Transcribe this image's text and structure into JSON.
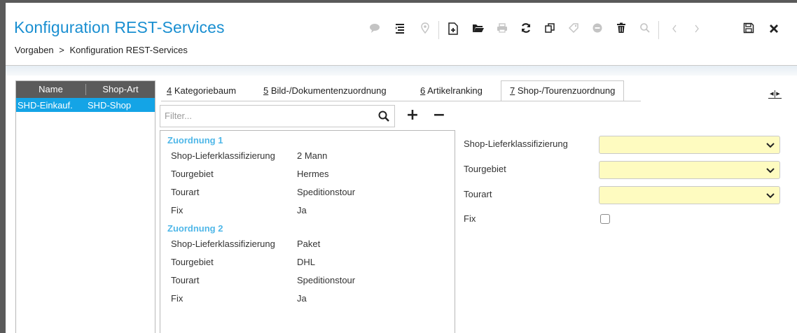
{
  "app": {
    "title": "Konfiguration REST-Services",
    "breadcrumb": {
      "root": "Vorgaben",
      "separator": ">",
      "current": "Konfiguration REST-Services"
    },
    "accent": "#1a8fd1"
  },
  "toolbar": {
    "icons": [
      "comment-icon",
      "list-icon",
      "location-icon",
      "new-document-icon",
      "folder-open-icon",
      "print-icon",
      "refresh-icon",
      "copy-icon",
      "tag-icon",
      "minus-circle-icon",
      "delete-icon",
      "search-icon",
      "prev-icon",
      "next-icon",
      "save-icon",
      "close-icon"
    ]
  },
  "left_list": {
    "headers": [
      "Name",
      "Shop-Art"
    ],
    "rows": [
      {
        "name": "SHD-Einkauf.",
        "shop_art": "SHD-Shop"
      }
    ],
    "selected_color": "#14a4e6"
  },
  "tabs": [
    {
      "key": "4",
      "label": "Kategoriebaum"
    },
    {
      "key": "5",
      "label": "Bild-/Dokumentenzuordnung"
    },
    {
      "key": "6",
      "label": "Artikelranking"
    },
    {
      "key": "7",
      "label": "Shop-/Tourenzuordnung",
      "active": true
    }
  ],
  "filter": {
    "placeholder": "Filter...",
    "value": ""
  },
  "assignments": [
    {
      "title": "Zuordnung 1",
      "fields": [
        {
          "label": "Shop-Lieferklassifizierung",
          "value": "2 Mann"
        },
        {
          "label": "Tourgebiet",
          "value": "Hermes"
        },
        {
          "label": "Tourart",
          "value": "Speditionstour"
        },
        {
          "label": "Fix",
          "value": "Ja"
        }
      ]
    },
    {
      "title": "Zuordnung 2",
      "fields": [
        {
          "label": "Shop-Lieferklassifizierung",
          "value": "Paket"
        },
        {
          "label": "Tourgebiet",
          "value": "DHL"
        },
        {
          "label": "Tourart",
          "value": "Speditionstour"
        },
        {
          "label": "Fix",
          "value": "Ja"
        }
      ]
    }
  ],
  "form": {
    "shop_lieferklassifizierung": {
      "label": "Shop-Lieferklassifizierung",
      "value": ""
    },
    "tourgebiet": {
      "label": "Tourgebiet",
      "value": ""
    },
    "tourart": {
      "label": "Tourart",
      "value": ""
    },
    "fix": {
      "label": "Fix",
      "checked": false
    },
    "required_color": "#fefbc0"
  }
}
